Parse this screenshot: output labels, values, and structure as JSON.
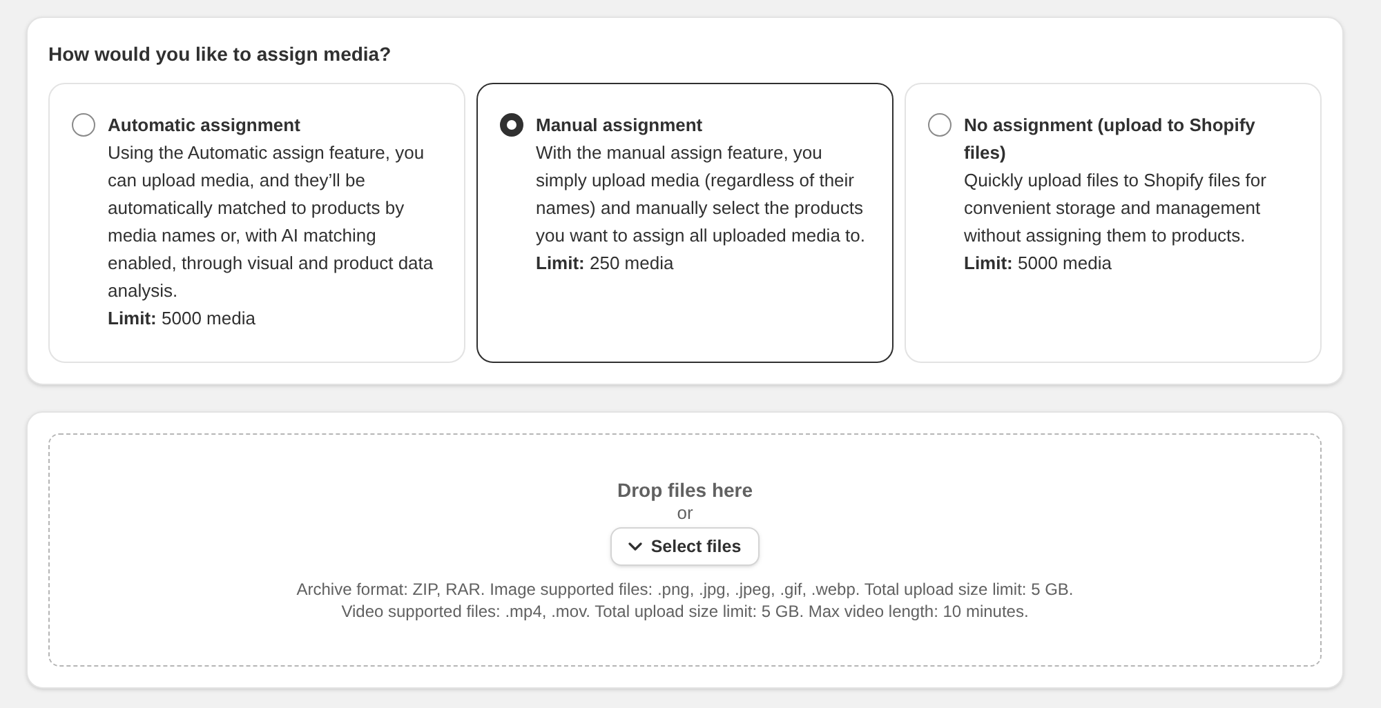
{
  "assign": {
    "title": "How would you like to assign media?",
    "options": [
      {
        "title": "Automatic assignment",
        "description": "Using the Automatic assign feature, you can upload media, and they’ll be automatically matched to products by media names or, with AI matching enabled, through visual and product data analysis.",
        "limit": "**Limit:** 5000 media",
        "selected": false
      },
      {
        "title": "Manual assignment",
        "description": "With the manual assign feature, you simply upload media (regardless of their names) and manually select the products you want to assign all uploaded media to.",
        "limit": "**Limit:** 250 media",
        "selected": true
      },
      {
        "title": "No assignment (upload to Shopify files)",
        "description": "Quickly upload files to Shopify files for convenient storage and management without assigning them to products.",
        "limit": "**Limit:** 5000 media",
        "selected": false
      }
    ]
  },
  "dropzone": {
    "heading": "Drop files here",
    "or": "or",
    "button": "Select files",
    "notes": [
      "Archive format: ZIP, RAR. Image supported files: .png, .jpg, .jpeg, .gif, .webp. Total upload size limit: 5 GB.",
      "Video supported files: .mp4, .mov. Total upload size limit: 5 GB. Max video length: 10 minutes."
    ]
  }
}
